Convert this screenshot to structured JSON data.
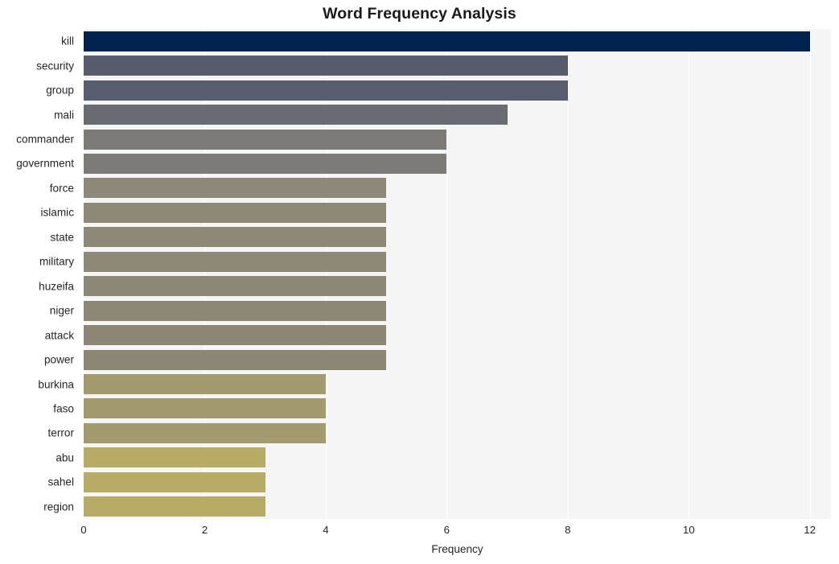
{
  "chart_data": {
    "type": "bar",
    "orientation": "horizontal",
    "title": "Word Frequency Analysis",
    "xlabel": "Frequency",
    "ylabel": "",
    "xlim": [
      0,
      12.35
    ],
    "ylim": [
      0,
      20
    ],
    "grid": true,
    "legend": null,
    "xticks": [
      "0",
      "2",
      "4",
      "6",
      "8",
      "10",
      "12"
    ],
    "xtick_values": [
      0,
      2,
      4,
      6,
      8,
      10,
      12
    ],
    "categories": [
      "kill",
      "security",
      "group",
      "mali",
      "commander",
      "government",
      "force",
      "islamic",
      "state",
      "military",
      "huzeifa",
      "niger",
      "attack",
      "power",
      "burkina",
      "faso",
      "terror",
      "abu",
      "sahel",
      "region"
    ],
    "values": [
      12,
      8,
      8,
      7,
      6,
      6,
      5,
      5,
      5,
      5,
      5,
      5,
      5,
      5,
      4,
      4,
      4,
      3,
      3,
      3
    ],
    "bar_colors": [
      "#00234f",
      "#565c6e",
      "#575c6e",
      "#6a6c74",
      "#7b7a77",
      "#7c7b78",
      "#8d8877",
      "#8e8976",
      "#8e8976",
      "#8e8876",
      "#8d8875",
      "#8d8875",
      "#8c8775",
      "#8c8774",
      "#a39a6d",
      "#a39a6d",
      "#a39a6d",
      "#b8ab66",
      "#b8ab66",
      "#b8ab66"
    ],
    "plot_background": "#f5f5f6",
    "gridline_color": "#ffffff",
    "figure_background": "#ffffff",
    "text_color": "#262626",
    "title_color": "#1a1a1a"
  }
}
